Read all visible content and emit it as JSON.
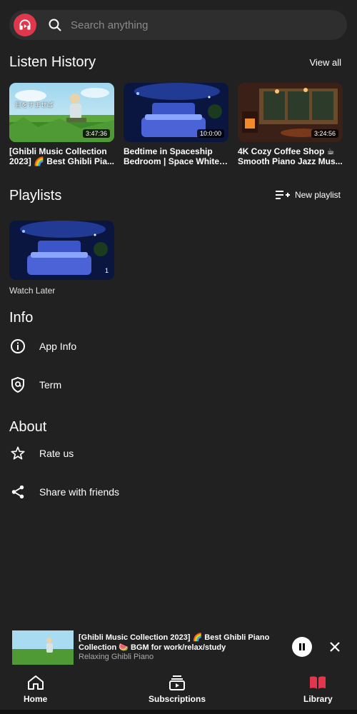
{
  "search": {
    "placeholder": "Search anything"
  },
  "listen_history": {
    "title": "Listen History",
    "view_all": "View all",
    "videos": [
      {
        "title": "[Ghibli Music Collection 2023] 🌈 Best Ghibli Pia...",
        "duration": "3:47:36",
        "thumb_text": "目をすませば"
      },
      {
        "title": "Bedtime in Spaceship Bedroom | Space White ...",
        "duration": "10:0:00"
      },
      {
        "title": "4K Cozy Coffee Shop ☕ Smooth Piano Jazz Mus...",
        "duration": "3:24:56"
      }
    ]
  },
  "playlists": {
    "title": "Playlists",
    "new_playlist": "New playlist",
    "items": [
      {
        "title": "Watch Later",
        "count": "1"
      }
    ]
  },
  "info": {
    "title": "Info",
    "items": [
      {
        "label": "App Info",
        "icon": "info-icon"
      },
      {
        "label": "Term",
        "icon": "shield-icon"
      }
    ]
  },
  "about": {
    "title": "About",
    "items": [
      {
        "label": "Rate us",
        "icon": "star-icon"
      },
      {
        "label": "Share with friends",
        "icon": "share-icon"
      }
    ]
  },
  "mini_player": {
    "title": "[Ghibli Music Collection 2023] 🌈 Best Ghibli Piano Collection 🍉 BGM for work/relax/study",
    "channel": "Relaxing Ghibli Piano"
  },
  "nav": {
    "home": "Home",
    "subscriptions": "Subscriptions",
    "library": "Library"
  },
  "colors": {
    "background": "#212121",
    "accent": "#e0374d",
    "search_bg": "#2e2e2e"
  }
}
